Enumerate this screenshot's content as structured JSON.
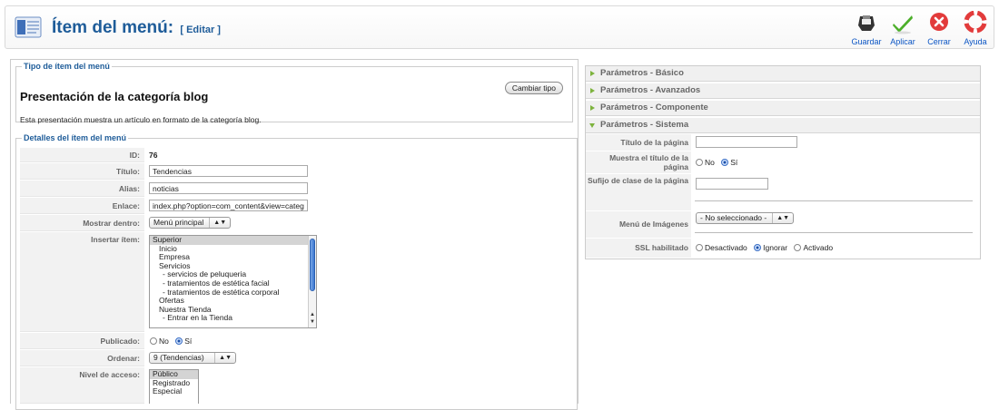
{
  "header": {
    "title": "Ítem del menú:",
    "subtitle": "[ Editar ]",
    "toolbar": [
      {
        "label": "Guardar",
        "icon": "save-icon"
      },
      {
        "label": "Aplicar",
        "icon": "apply-checkmark-icon"
      },
      {
        "label": "Cerrar",
        "icon": "close-icon"
      },
      {
        "label": "Ayuda",
        "icon": "help-lifebuoy-icon"
      }
    ]
  },
  "type_box": {
    "legend": "Tipo de ítem del menú",
    "change_button": "Cambiar tipo",
    "title": "Presentación de la categoría blog",
    "description": "Esta presentación muestra un artículo en formato de la categoría blog."
  },
  "details": {
    "legend": "Detalles del ítem del menú",
    "id_label": "ID:",
    "id_value": "76",
    "titulo_label": "Título:",
    "titulo_value": "Tendencias",
    "alias_label": "Alias:",
    "alias_value": "noticias",
    "enlace_label": "Enlace:",
    "enlace_value": "index.php?option=com_content&view=categ",
    "mostrar_label": "Mostrar dentro:",
    "mostrar_value": "Menú principal",
    "insertar_label": "Insertar ítem:",
    "insertar_options": [
      "Superior",
      "Inicio",
      "Empresa",
      "Servicios",
      "- servicios de peluqueria",
      "- tratamientos de estética facial",
      "- tratamientos de estética corporal",
      "Ofertas",
      "Nuestra Tienda",
      "- Entrar en la Tienda"
    ],
    "publicado_label": "Publicado:",
    "publicado_no": "No",
    "publicado_si": "Sí",
    "ordenar_label": "Ordenar:",
    "ordenar_value": "9 (Tendencias)",
    "acceso_label": "Nivel de acceso:",
    "acceso_options": [
      "Público",
      "Registrado",
      "Especial"
    ]
  },
  "params": {
    "basico": "Parámetros - Básico",
    "avanzados": "Parámetros - Avanzados",
    "componente": "Parámetros - Componente",
    "sistema": "Parámetros - Sistema",
    "titulo_pagina_label": "Título de la página",
    "muestra_titulo_label": "Muestra el título de la página",
    "muestra_no": "No",
    "muestra_si": "Sí",
    "sufijo_label": "Sufijo de clase de la página",
    "menu_imagenes_label": "Menú de Imágenes",
    "menu_imagenes_value": "- No seleccionado -",
    "ssl_label": "SSL habilitado",
    "ssl_desactivado": "Desactivado",
    "ssl_ignorar": "Ignorar",
    "ssl_activado": "Activado"
  }
}
